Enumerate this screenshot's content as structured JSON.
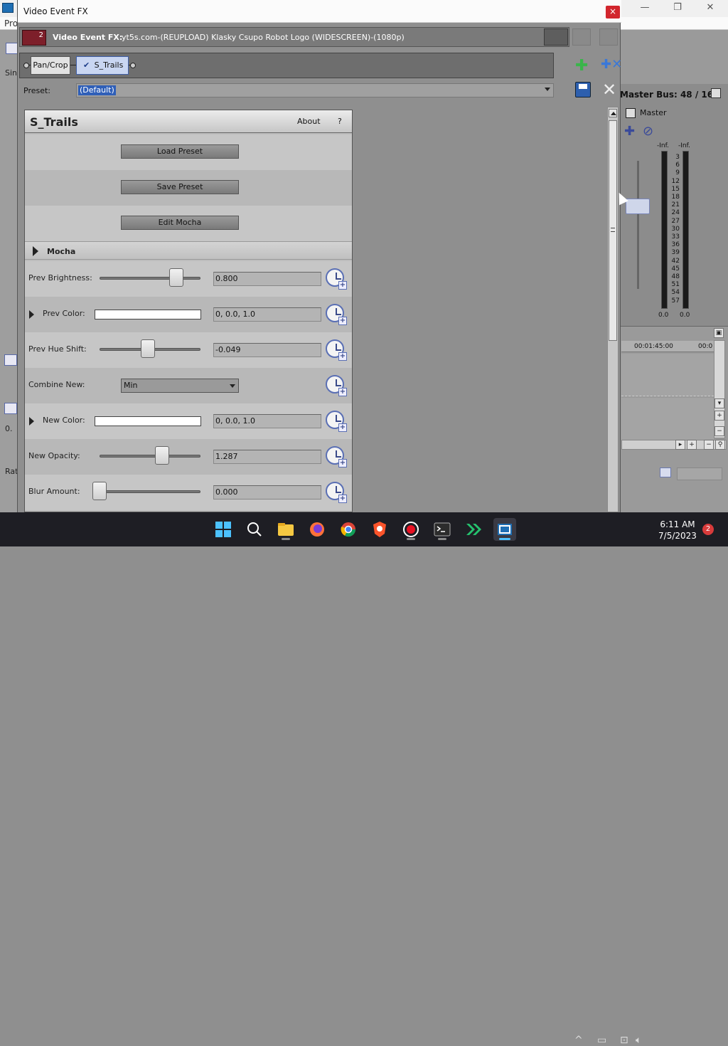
{
  "background_app": {
    "menu_partial": "Pro",
    "left_strip_texts": [
      "Sin",
      "0.",
      "Rat"
    ],
    "master_bus": {
      "title": "Master Bus: 48 / 16",
      "channel_label": "Master",
      "peak_left": "-Inf.",
      "peak_right": "-Inf.",
      "scale": [
        "3",
        "6",
        "9",
        "12",
        "15",
        "18",
        "21",
        "24",
        "27",
        "30",
        "33",
        "36",
        "39",
        "42",
        "45",
        "48",
        "51",
        "54",
        "57"
      ],
      "bottom_left": "0.0",
      "bottom_right": "0.0"
    },
    "timeline": {
      "time_1": "00:01:45:00",
      "time_2": "00:0"
    }
  },
  "fx_window": {
    "title": "Video Event FX",
    "close_glyph": "×",
    "header": {
      "badge_number": "2",
      "label": "Video Event FX:",
      "media_name": "yt5s.com-(REUPLOAD) Klasky Csupo Robot Logo (WIDESCREEN)-(1080p)"
    },
    "chain": {
      "tabs": [
        {
          "label": "Pan/Crop",
          "active": false
        },
        {
          "label": "S_Trails",
          "active": true
        }
      ],
      "check_glyph": "✔"
    },
    "preset": {
      "label": "Preset:",
      "value": "(Default)"
    }
  },
  "plugin": {
    "title": "S_Trails",
    "about_label": "About",
    "help_label": "?",
    "buttons": {
      "load_preset": "Load Preset",
      "save_preset": "Save Preset",
      "edit_mocha": "Edit Mocha"
    },
    "section_mocha": "Mocha",
    "params": {
      "prev_brightness": {
        "label": "Prev Brightness:",
        "value": "0.800",
        "level": 0.8
      },
      "prev_color": {
        "label": "Prev Color:",
        "value": "0, 0.0, 1.0"
      },
      "prev_hue_shift": {
        "label": "Prev Hue Shift:",
        "value": "-0.049",
        "level": 0.475
      },
      "combine_new": {
        "label": "Combine New:",
        "value": "Min"
      },
      "new_color": {
        "label": "New Color:",
        "value": "0, 0.0, 1.0"
      },
      "new_opacity": {
        "label": "New Opacity:",
        "value": "1.287",
        "level": 0.643
      },
      "blur_amount": {
        "label": "Blur Amount:",
        "value": "0.000",
        "level": 0.0
      }
    }
  },
  "taskbar": {
    "time": "6:11 AM",
    "date": "7/5/2023",
    "notification_count": "2",
    "tray_chevron": "^"
  },
  "colors": {
    "accent": "#2f5fb8",
    "close_red": "#d2262d",
    "add_green": "#39b54a"
  }
}
